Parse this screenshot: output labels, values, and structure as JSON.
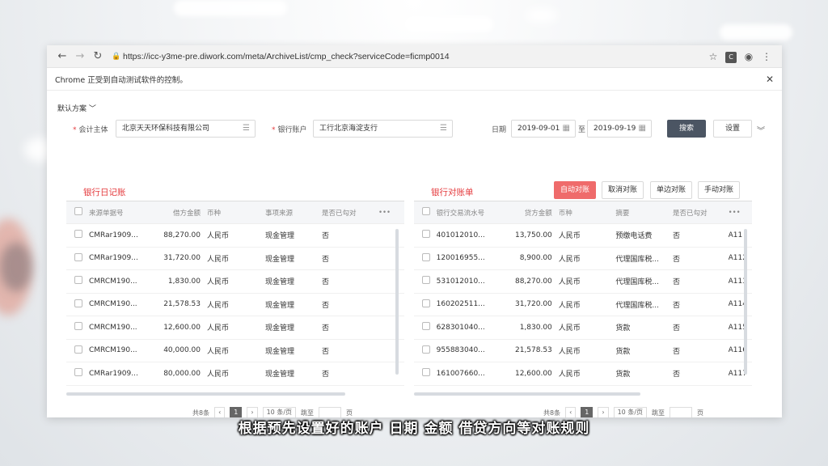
{
  "browser": {
    "url": "https://icc-y3me-pre.diwork.com/meta/ArchiveList/cmp_check?serviceCode=ficmp0014",
    "ext_label": "C",
    "infobar_text": "Chrome 正受到自动测试软件的控制。"
  },
  "filters": {
    "scheme": "默认方案",
    "entity_label": "会计主体",
    "entity_value": "北京天天环保科技有限公司",
    "account_label": "银行账户",
    "account_value": "工行北京海淀支行",
    "date_label": "日期",
    "date_from": "2019-09-01",
    "date_sep": "至",
    "date_to": "2019-09-19",
    "search_btn": "搜索",
    "settings_btn": "设置"
  },
  "journal": {
    "title": "银行日记账",
    "columns": [
      "来源单据号",
      "借方金额",
      "币种",
      "事项来源",
      "是否已勾对",
      "•••"
    ],
    "rows": [
      [
        "CMRar1909...",
        "88,270.00",
        "人民币",
        "现金管理",
        "否"
      ],
      [
        "CMRar1909...",
        "31,720.00",
        "人民币",
        "现金管理",
        "否"
      ],
      [
        "CMRCM190...",
        "1,830.00",
        "人民币",
        "现金管理",
        "否"
      ],
      [
        "CMRCM190...",
        "21,578.53",
        "人民币",
        "现金管理",
        "否"
      ],
      [
        "CMRCM190...",
        "12,600.00",
        "人民币",
        "现金管理",
        "否"
      ],
      [
        "CMRCM190...",
        "40,000.00",
        "人民币",
        "现金管理",
        "否"
      ],
      [
        "CMRar1909...",
        "80,000.00",
        "人民币",
        "现金管理",
        "否"
      ]
    ],
    "pager_total": "共8条",
    "pager_page": "1",
    "pager_size": "10 条/页",
    "pager_jump": "跳至",
    "pager_unit": "页"
  },
  "statement": {
    "title": "银行对账单",
    "actions": [
      "自动对账",
      "取消对账",
      "单边对账",
      "手动对账"
    ],
    "columns": [
      "银行交易流水号",
      "贷方金额",
      "币种",
      "摘要",
      "是否已勾对",
      "•••"
    ],
    "rows": [
      [
        "401012010...",
        "13,750.00",
        "人民币",
        "预缴电话费",
        "否",
        "A11"
      ],
      [
        "120016955...",
        "8,900.00",
        "人民币",
        "代理国库税...",
        "否",
        "A112"
      ],
      [
        "531012010...",
        "88,270.00",
        "人民币",
        "代理国库税...",
        "否",
        "A113"
      ],
      [
        "160202511...",
        "31,720.00",
        "人民币",
        "代理国库税...",
        "否",
        "A114"
      ],
      [
        "628301040...",
        "1,830.00",
        "人民币",
        "货款",
        "否",
        "A115"
      ],
      [
        "955883040...",
        "21,578.53",
        "人民币",
        "货款",
        "否",
        "A116"
      ],
      [
        "161007660...",
        "12,600.00",
        "人民币",
        "货款",
        "否",
        "A117"
      ]
    ],
    "pager_total": "共8条",
    "pager_page": "1",
    "pager_size": "10 条/页",
    "pager_jump": "跳至",
    "pager_unit": "页"
  },
  "subtitle": "根据预先设置好的账户  日期  金额  借贷方向等对账规则"
}
